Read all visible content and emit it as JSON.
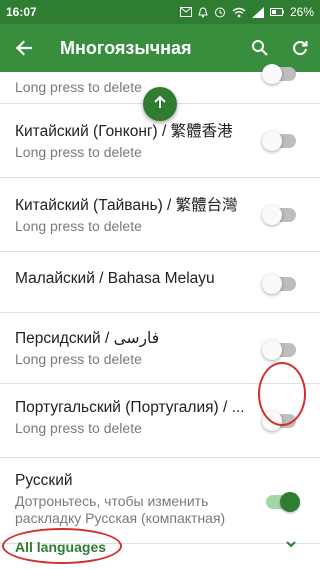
{
  "status_bar": {
    "time": "16:07",
    "battery": "26%",
    "icons": [
      "mail-icon",
      "notification-icon",
      "alarm-icon",
      "wifi-icon",
      "signal-icon",
      "battery-icon"
    ]
  },
  "app_bar": {
    "back_icon": "arrow-back-icon",
    "title": "Многоязычная",
    "search_icon": "search-icon",
    "refresh_icon": "refresh-icon"
  },
  "fab_icon": "arrow-up-icon",
  "colors": {
    "primary": "#388e3c",
    "primary_dark": "#2e7d32",
    "annotation": "#d32f2f"
  },
  "languages": [
    {
      "name": "",
      "subtitle": "Long press to delete",
      "enabled": false
    },
    {
      "name": "Китайский (Гонконг) / 繁體香港",
      "subtitle": "Long press to delete",
      "enabled": false
    },
    {
      "name": "Китайский (Тайвань) / 繁體台灣",
      "subtitle": "Long press to delete",
      "enabled": false
    },
    {
      "name": "Малайский / Bahasa Melayu",
      "subtitle": "Long press to delete",
      "enabled": false
    },
    {
      "name": "Персидский / فارسی",
      "subtitle": "Long press to delete",
      "enabled": false
    },
    {
      "name": "Португальский (Португалия) / ...",
      "subtitle": "Long press to delete",
      "enabled": false
    },
    {
      "name": "Русский",
      "subtitle": "Дотроньтесь, чтобы изменить раскладку Русская (компактная)",
      "enabled": true
    }
  ],
  "footer": {
    "label": "All languages",
    "chevron_icon": "chevron-down-icon"
  }
}
